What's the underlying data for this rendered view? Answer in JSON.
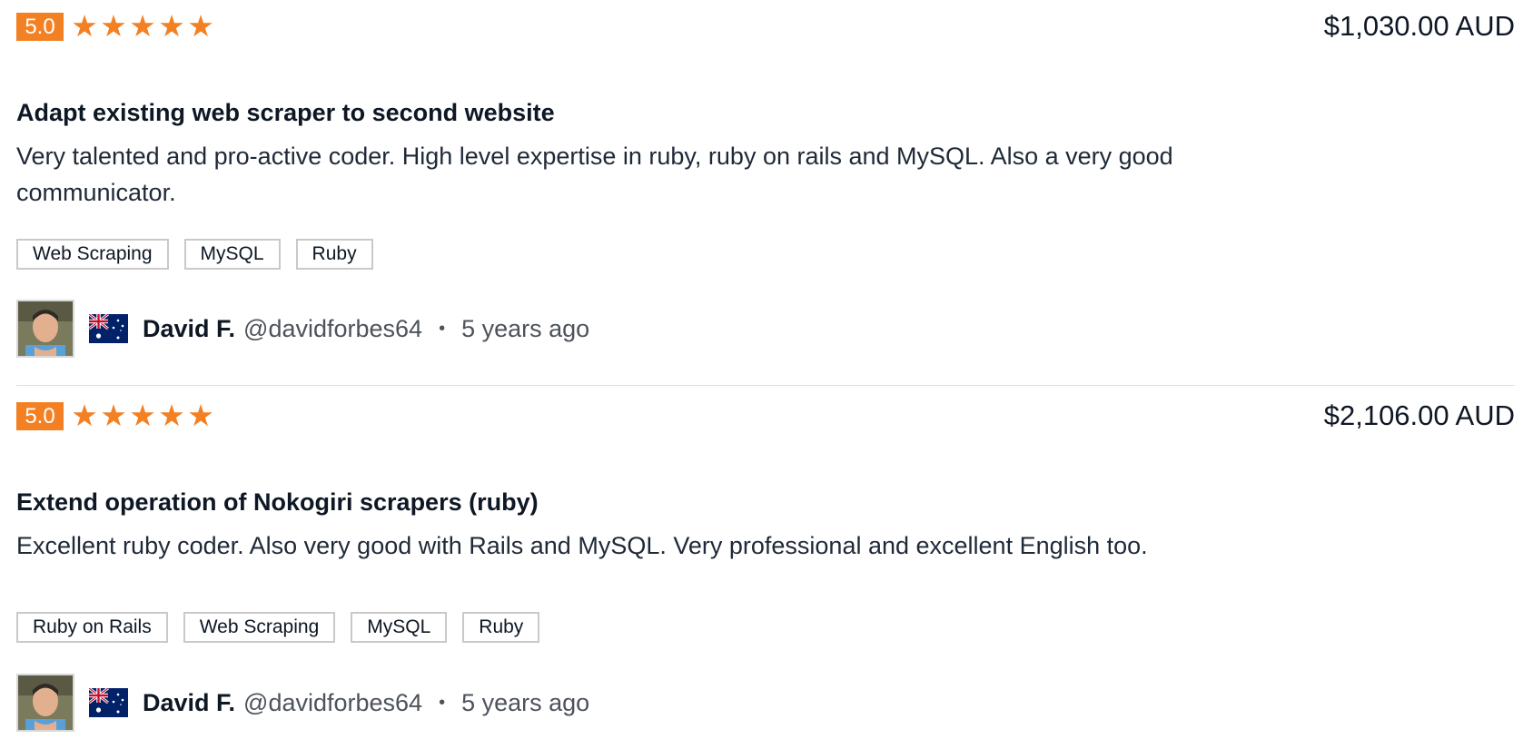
{
  "reviews": [
    {
      "rating": "5.0",
      "stars": 5,
      "amount": "$1,030.00 AUD",
      "title": "Adapt existing web scraper to second website",
      "text": "Very talented and pro-active coder. High level expertise in ruby, ruby on rails and MySQL. Also a very good communicator.",
      "tags": [
        "Web Scraping",
        "MySQL",
        "Ruby"
      ],
      "reviewer": {
        "name": "David F.",
        "handle": "@davidforbes64",
        "country_flag": "australia-flag-icon",
        "time": "5 years ago"
      }
    },
    {
      "rating": "5.0",
      "stars": 5,
      "amount": "$2,106.00 AUD",
      "title": "Extend operation of Nokogiri scrapers (ruby)",
      "text": "Excellent ruby coder. Also very good with Rails and MySQL. Very professional and excellent English too.",
      "tags": [
        "Ruby on Rails",
        "Web Scraping",
        "MySQL",
        "Ruby"
      ],
      "reviewer": {
        "name": "David F.",
        "handle": "@davidforbes64",
        "country_flag": "australia-flag-icon",
        "time": "5 years ago"
      }
    }
  ],
  "separator": "•",
  "star_glyph": "★",
  "colors": {
    "accent": "#f48024",
    "text": "#0e1724",
    "muted": "#4d525b",
    "divider": "#dedede"
  }
}
